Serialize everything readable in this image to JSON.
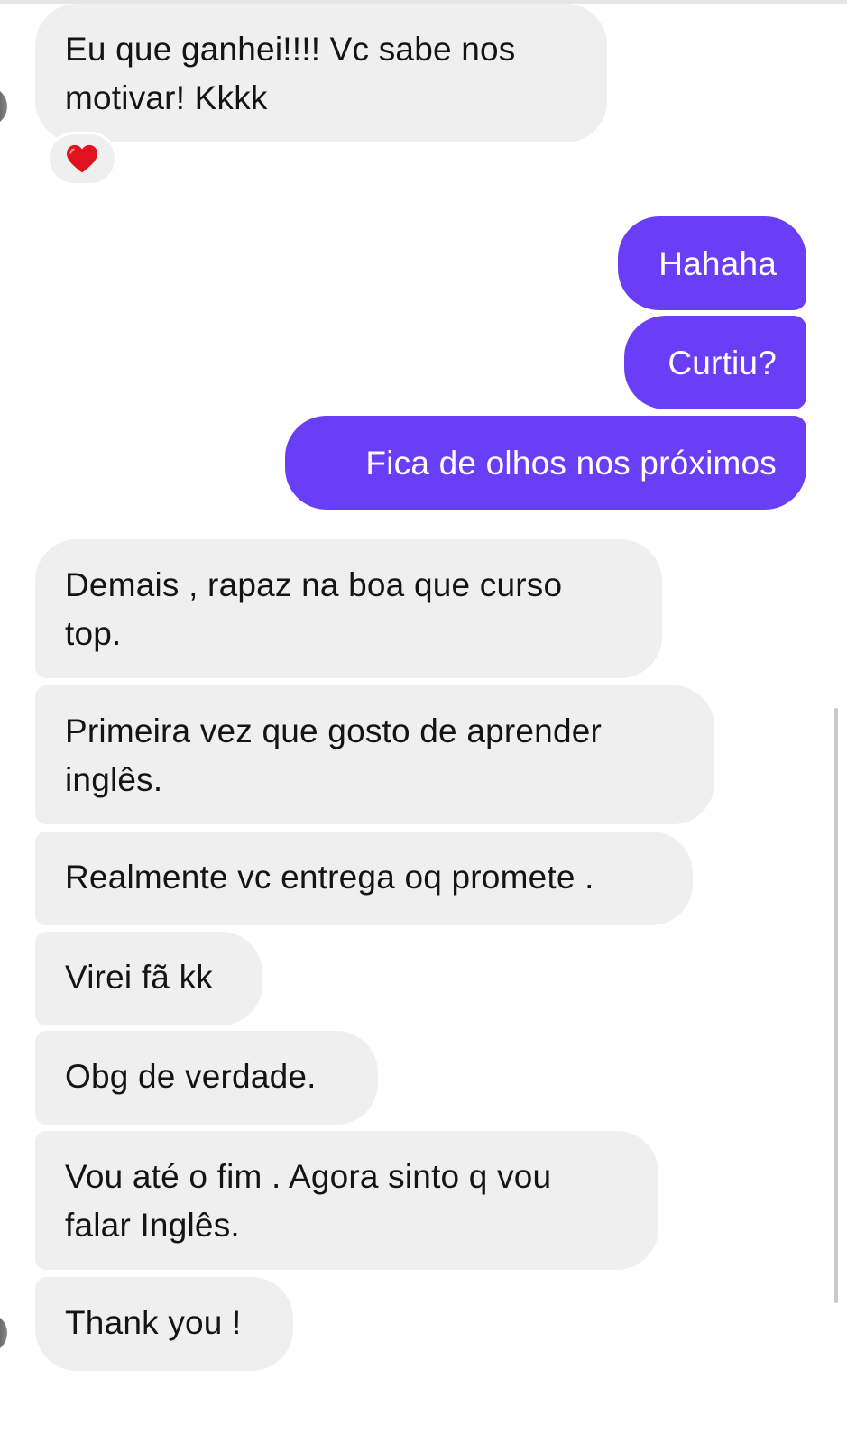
{
  "conversation": {
    "incoming_top": {
      "lines": [
        "Eu que ganhei!!!! Vc sabe nos",
        "motivar! Kkkk"
      ],
      "reaction_icon": "heart-icon"
    },
    "outgoing": [
      {
        "text": "Hahaha"
      },
      {
        "text": "Curtiu?"
      },
      {
        "text": "Fica de olhos nos próximos"
      }
    ],
    "incoming": [
      {
        "lines": [
          "Demais , rapaz na boa que curso",
          "top."
        ]
      },
      {
        "lines": [
          "Primeira vez que gosto de aprender",
          "inglês."
        ]
      },
      {
        "lines": [
          "Realmente vc entrega oq promete ."
        ]
      },
      {
        "lines": [
          "Virei fã kk"
        ]
      },
      {
        "lines": [
          "Obg de verdade."
        ]
      },
      {
        "lines": [
          "Vou até o fim . Agora sinto q vou",
          "falar Inglês."
        ]
      },
      {
        "lines": [
          "Thank you !"
        ]
      }
    ]
  },
  "colors": {
    "outgoing_bubble": "#6a3ef7",
    "incoming_bubble": "#efefef",
    "reaction_heart": "#e0121d"
  }
}
